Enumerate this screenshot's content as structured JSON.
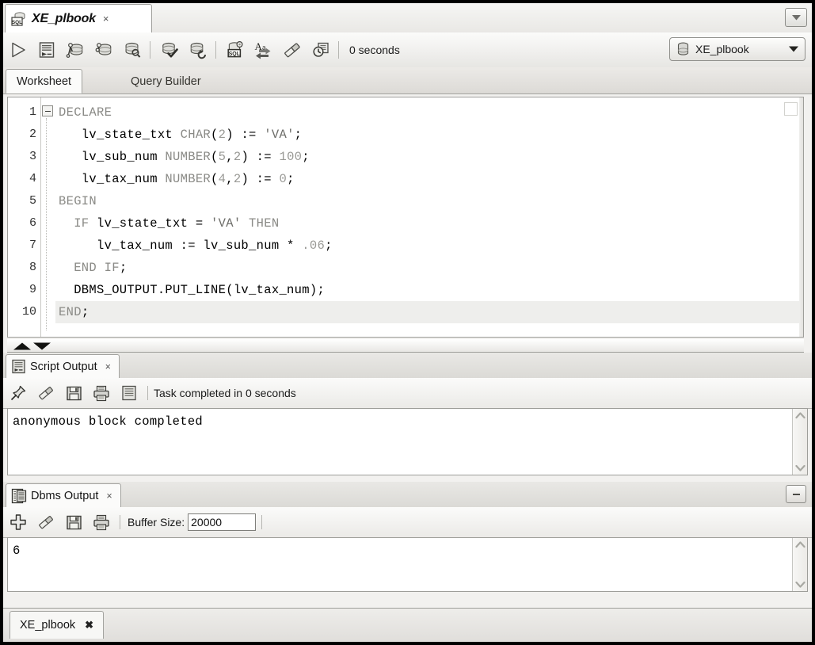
{
  "window": {
    "document_tab": {
      "title": "XE_plbook",
      "close_label": "×",
      "icon": "sql-worksheet-icon"
    },
    "tabstrip_dropdown_icon": "chevron-down-icon"
  },
  "toolbar": {
    "buttons": [
      {
        "name": "run-statement-button",
        "icon": "play-triangle-icon",
        "tooltip": "Run Statement"
      },
      {
        "name": "run-script-button",
        "icon": "script-page-icon",
        "tooltip": "Run Script"
      },
      {
        "name": "commit-button",
        "icon": "commit-database-icon",
        "tooltip": "Commit"
      },
      {
        "name": "rollback-button",
        "icon": "rollback-database-icon",
        "tooltip": "Rollback"
      },
      {
        "name": "unshared-sql-button",
        "icon": "database-search-icon",
        "tooltip": "Unshared SQL Worksheet"
      },
      {
        "name": "explain-plan-button",
        "icon": "database-check-icon",
        "tooltip": "Explain Plan"
      },
      {
        "name": "autotrace-button",
        "icon": "database-refresh-icon",
        "tooltip": "Autotrace"
      },
      {
        "name": "sql-history-button",
        "icon": "sql-gear-icon",
        "tooltip": "SQL Tuning Advisor"
      },
      {
        "name": "format-button",
        "icon": "aa-format-icon",
        "tooltip": "Format"
      },
      {
        "name": "clear-button",
        "icon": "eraser-icon",
        "tooltip": "Clear"
      },
      {
        "name": "history-button",
        "icon": "clock-history-icon",
        "tooltip": "SQL History"
      }
    ],
    "elapsed_text": "0 seconds",
    "connection": {
      "name": "XE_plbook",
      "icon": "database-icon",
      "arrow_icon": "triangle-down-icon"
    }
  },
  "worksheet_tabs": [
    {
      "label": "Worksheet",
      "active": true
    },
    {
      "label": "Query Builder",
      "active": false
    }
  ],
  "editor": {
    "fold_icon": "fold-minus-icon",
    "lines": [
      {
        "n": "1",
        "segments": [
          {
            "t": "DECLARE",
            "c": "kw"
          }
        ]
      },
      {
        "n": "2",
        "segments": [
          {
            "t": "   lv_state_txt ",
            "c": ""
          },
          {
            "t": "CHAR",
            "c": "kw"
          },
          {
            "t": "(",
            "c": ""
          },
          {
            "t": "2",
            "c": "num"
          },
          {
            "t": ") := ",
            "c": ""
          },
          {
            "t": "'VA'",
            "c": "str"
          },
          {
            "t": ";",
            "c": ""
          }
        ]
      },
      {
        "n": "3",
        "segments": [
          {
            "t": "   lv_sub_num ",
            "c": ""
          },
          {
            "t": "NUMBER",
            "c": "kw"
          },
          {
            "t": "(",
            "c": ""
          },
          {
            "t": "5",
            "c": "num"
          },
          {
            "t": ",",
            "c": ""
          },
          {
            "t": "2",
            "c": "num"
          },
          {
            "t": ") := ",
            "c": ""
          },
          {
            "t": "100",
            "c": "num"
          },
          {
            "t": ";",
            "c": ""
          }
        ]
      },
      {
        "n": "4",
        "segments": [
          {
            "t": "   lv_tax_num ",
            "c": ""
          },
          {
            "t": "NUMBER",
            "c": "kw"
          },
          {
            "t": "(",
            "c": ""
          },
          {
            "t": "4",
            "c": "num"
          },
          {
            "t": ",",
            "c": ""
          },
          {
            "t": "2",
            "c": "num"
          },
          {
            "t": ") := ",
            "c": ""
          },
          {
            "t": "0",
            "c": "num"
          },
          {
            "t": ";",
            "c": ""
          }
        ]
      },
      {
        "n": "5",
        "segments": [
          {
            "t": "BEGIN",
            "c": "kw"
          }
        ]
      },
      {
        "n": "6",
        "segments": [
          {
            "t": "  ",
            "c": ""
          },
          {
            "t": "IF",
            "c": "kw"
          },
          {
            "t": " lv_state_txt = ",
            "c": ""
          },
          {
            "t": "'VA'",
            "c": "str"
          },
          {
            "t": " ",
            "c": ""
          },
          {
            "t": "THEN",
            "c": "kw"
          }
        ]
      },
      {
        "n": "7",
        "segments": [
          {
            "t": "     lv_tax_num := lv_sub_num * ",
            "c": ""
          },
          {
            "t": ".06",
            "c": "num"
          },
          {
            "t": ";",
            "c": ""
          }
        ]
      },
      {
        "n": "8",
        "segments": [
          {
            "t": "  ",
            "c": ""
          },
          {
            "t": "END IF",
            "c": "kw"
          },
          {
            "t": ";",
            "c": ""
          }
        ]
      },
      {
        "n": "9",
        "segments": [
          {
            "t": "  DBMS_OUTPUT.PUT_LINE(lv_tax_num);",
            "c": ""
          }
        ]
      },
      {
        "n": "10",
        "segments": [
          {
            "t": "END",
            "c": "kw"
          },
          {
            "t": ";",
            "c": ""
          }
        ],
        "highlight": true
      }
    ]
  },
  "splitter": {
    "up_icon": "triangle-up-icon",
    "down_icon": "triangle-down-icon"
  },
  "script_output": {
    "tab": {
      "label": "Script Output",
      "close_label": "×",
      "icon": "script-output-icon"
    },
    "buttons": [
      {
        "name": "pin-output-button",
        "icon": "pin-icon",
        "tooltip": "Pin"
      },
      {
        "name": "clear-output-button",
        "icon": "eraser-icon",
        "tooltip": "Clear"
      },
      {
        "name": "save-output-button",
        "icon": "floppy-save-icon",
        "tooltip": "Save"
      },
      {
        "name": "print-output-button",
        "icon": "printer-icon",
        "tooltip": "Print"
      },
      {
        "name": "wrap-output-button",
        "icon": "script-page-icon",
        "tooltip": "Wrap"
      }
    ],
    "status_text": "Task completed in 0 seconds",
    "content": "anonymous block completed",
    "scroll_up_icon": "chevron-up-icon",
    "scroll_down_icon": "chevron-down-icon"
  },
  "dbms_output": {
    "tab": {
      "label": "Dbms Output",
      "close_label": "×",
      "icon": "dbms-output-icon"
    },
    "minimize_icon": "minimize-icon",
    "buttons": [
      {
        "name": "enable-dbms-output-button",
        "icon": "plus-icon",
        "tooltip": "Enable Dbms Output"
      },
      {
        "name": "clear-dbms-output-button",
        "icon": "eraser-icon",
        "tooltip": "Clear"
      },
      {
        "name": "save-dbms-output-button",
        "icon": "floppy-save-icon",
        "tooltip": "Save"
      },
      {
        "name": "print-dbms-output-button",
        "icon": "printer-icon",
        "tooltip": "Print"
      }
    ],
    "buffer_size_label": "Buffer Size:",
    "buffer_size_value": "20000",
    "content": "6",
    "scroll_up_icon": "chevron-up-icon",
    "scroll_down_icon": "chevron-down-icon"
  },
  "bottom_tab": {
    "label": "XE_plbook",
    "close_label": "✖"
  },
  "colors": {
    "keyword": "#8a8a86",
    "identifier": "#000000",
    "number": "#9a9a96",
    "frame": "#000000",
    "panel_bg": "#f2f1ef"
  }
}
